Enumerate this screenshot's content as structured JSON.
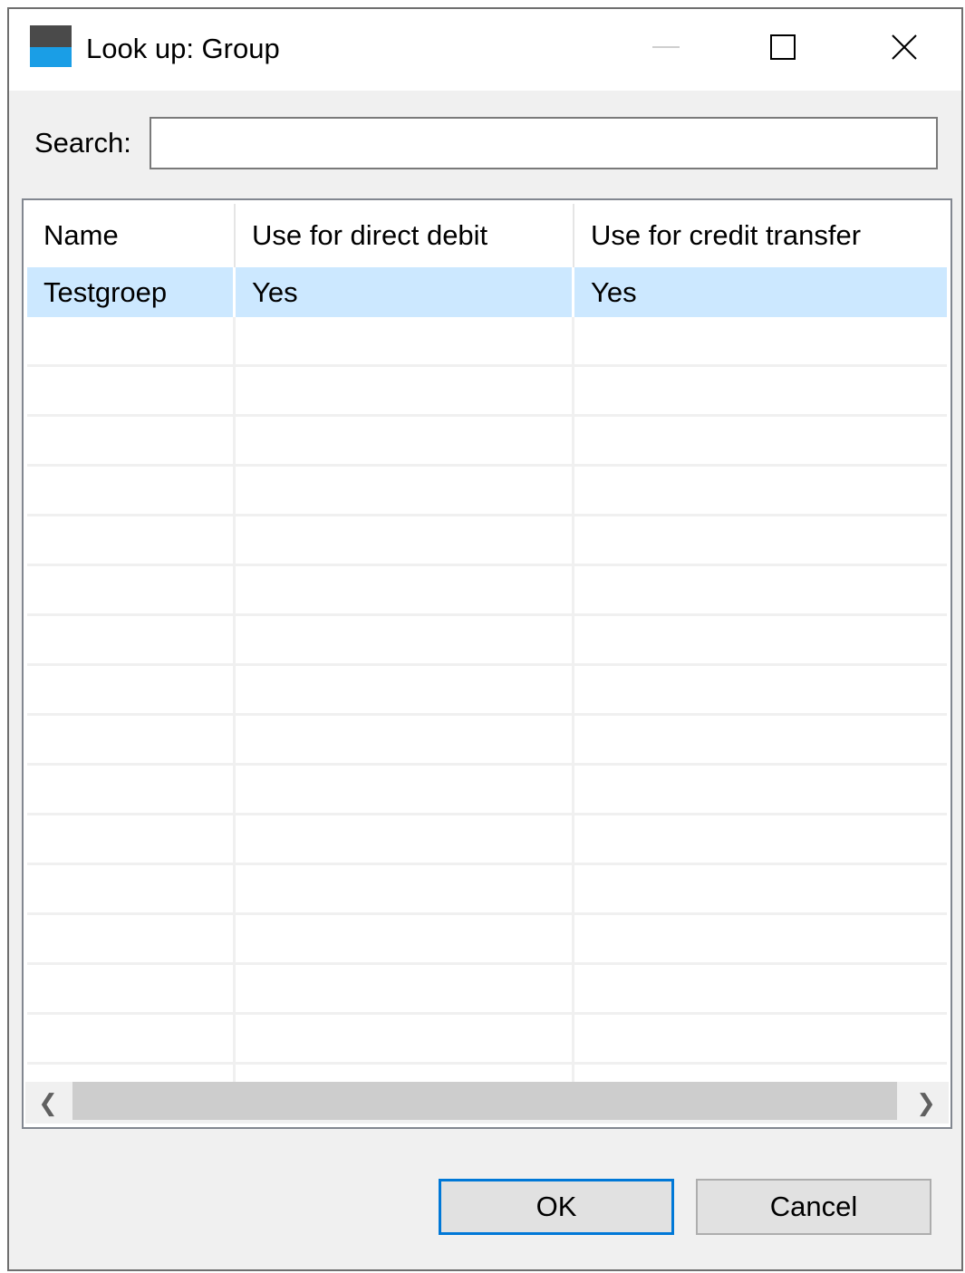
{
  "window": {
    "title": "Look up: Group",
    "controls": {
      "minimize_icon": "minimize-icon",
      "maximize_icon": "maximize-icon",
      "close_icon": "close-icon",
      "close_glyph": "✕"
    }
  },
  "search": {
    "label": "Search:",
    "value": "",
    "placeholder": ""
  },
  "table": {
    "columns": [
      "Name",
      "Use for direct debit",
      "Use for credit transfer"
    ],
    "rows": [
      {
        "name": "Testgroep",
        "direct_debit": "Yes",
        "credit_transfer": "Yes",
        "selected": true
      }
    ]
  },
  "scrollbar": {
    "left_glyph": "❮",
    "right_glyph": "❯"
  },
  "buttons": {
    "ok": "OK",
    "cancel": "Cancel"
  },
  "colors": {
    "selection": "#cce8ff",
    "focus_border": "#0078d7",
    "icon_top": "#4a4a4a",
    "icon_bottom": "#1a9ee6"
  }
}
